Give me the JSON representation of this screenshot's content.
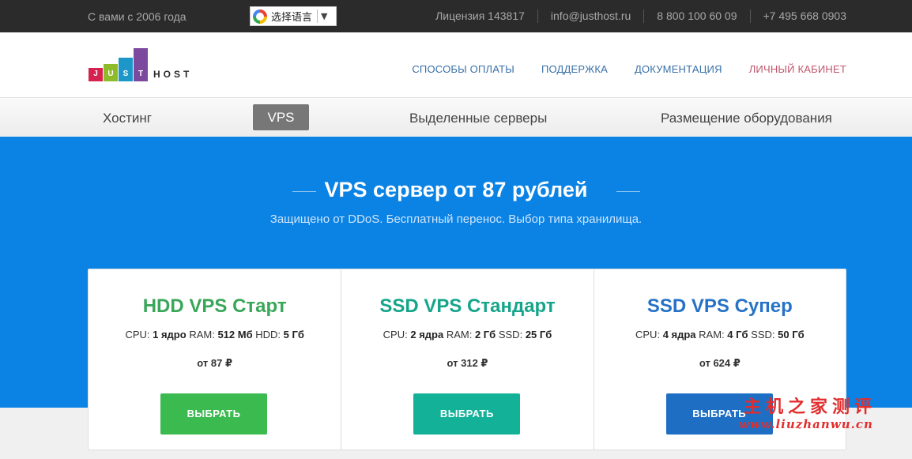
{
  "topbar": {
    "since": "С вами с 2006 года",
    "translate_label": "选择语言",
    "translate_arrow": "▼",
    "contacts": [
      "Лицензия 143817",
      "info@justhost.ru",
      "8 800 100 60 09",
      "+7 495 668 0903"
    ]
  },
  "logo": {
    "letters": [
      "J",
      "U",
      "S",
      "T"
    ],
    "host": "HOST"
  },
  "nav": {
    "items": [
      "СПОСОБЫ ОПЛАТЫ",
      "ПОДДЕРЖКА",
      "ДОКУМЕНТАЦИЯ",
      "ЛИЧНЫЙ КАБИНЕТ"
    ]
  },
  "menu": {
    "items": [
      "Хостинг",
      "VPS",
      "Выделенные серверы",
      "Размещение оборудования"
    ],
    "active": "VPS"
  },
  "hero": {
    "title": "VPS сервер от 87 рублей",
    "subtitle": "Защищено от DDoS. Бесплатный перенос. Выбор типа хранилища."
  },
  "plans": [
    {
      "name": "HDD VPS Старт",
      "cpu_label": "CPU:",
      "cpu": "1 ядро",
      "ram_label": "RAM:",
      "ram": "512 Мб",
      "disk_label": "HDD:",
      "disk": "5 Гб",
      "price": "от 87 ₽",
      "button": "ВЫБРАТЬ",
      "color": "#3aa65a"
    },
    {
      "name": "SSD VPS Стандарт",
      "cpu_label": "CPU:",
      "cpu": "2 ядра",
      "ram_label": "RAM:",
      "ram": "2 Гб",
      "disk_label": "SSD:",
      "disk": "25 Гб",
      "price": "от 312 ₽",
      "button": "ВЫБРАТЬ",
      "color": "#16a58a"
    },
    {
      "name": "SSD VPS Супер",
      "cpu_label": "CPU:",
      "cpu": "4 ядра",
      "ram_label": "RAM:",
      "ram": "4 Гб",
      "disk_label": "SSD:",
      "disk": "50 Гб",
      "price": "от 624 ₽",
      "button": "ВЫБРАТЬ",
      "color": "#2672c6"
    }
  ],
  "watermark": {
    "text": "主机之家测评",
    "url": "www.liuzhanwu.cn"
  },
  "colors": {
    "hero": "#0a83e5",
    "topbar": "#2b2b2b",
    "nav_link": "#3870a8",
    "cabinet_link": "#c0566b"
  }
}
